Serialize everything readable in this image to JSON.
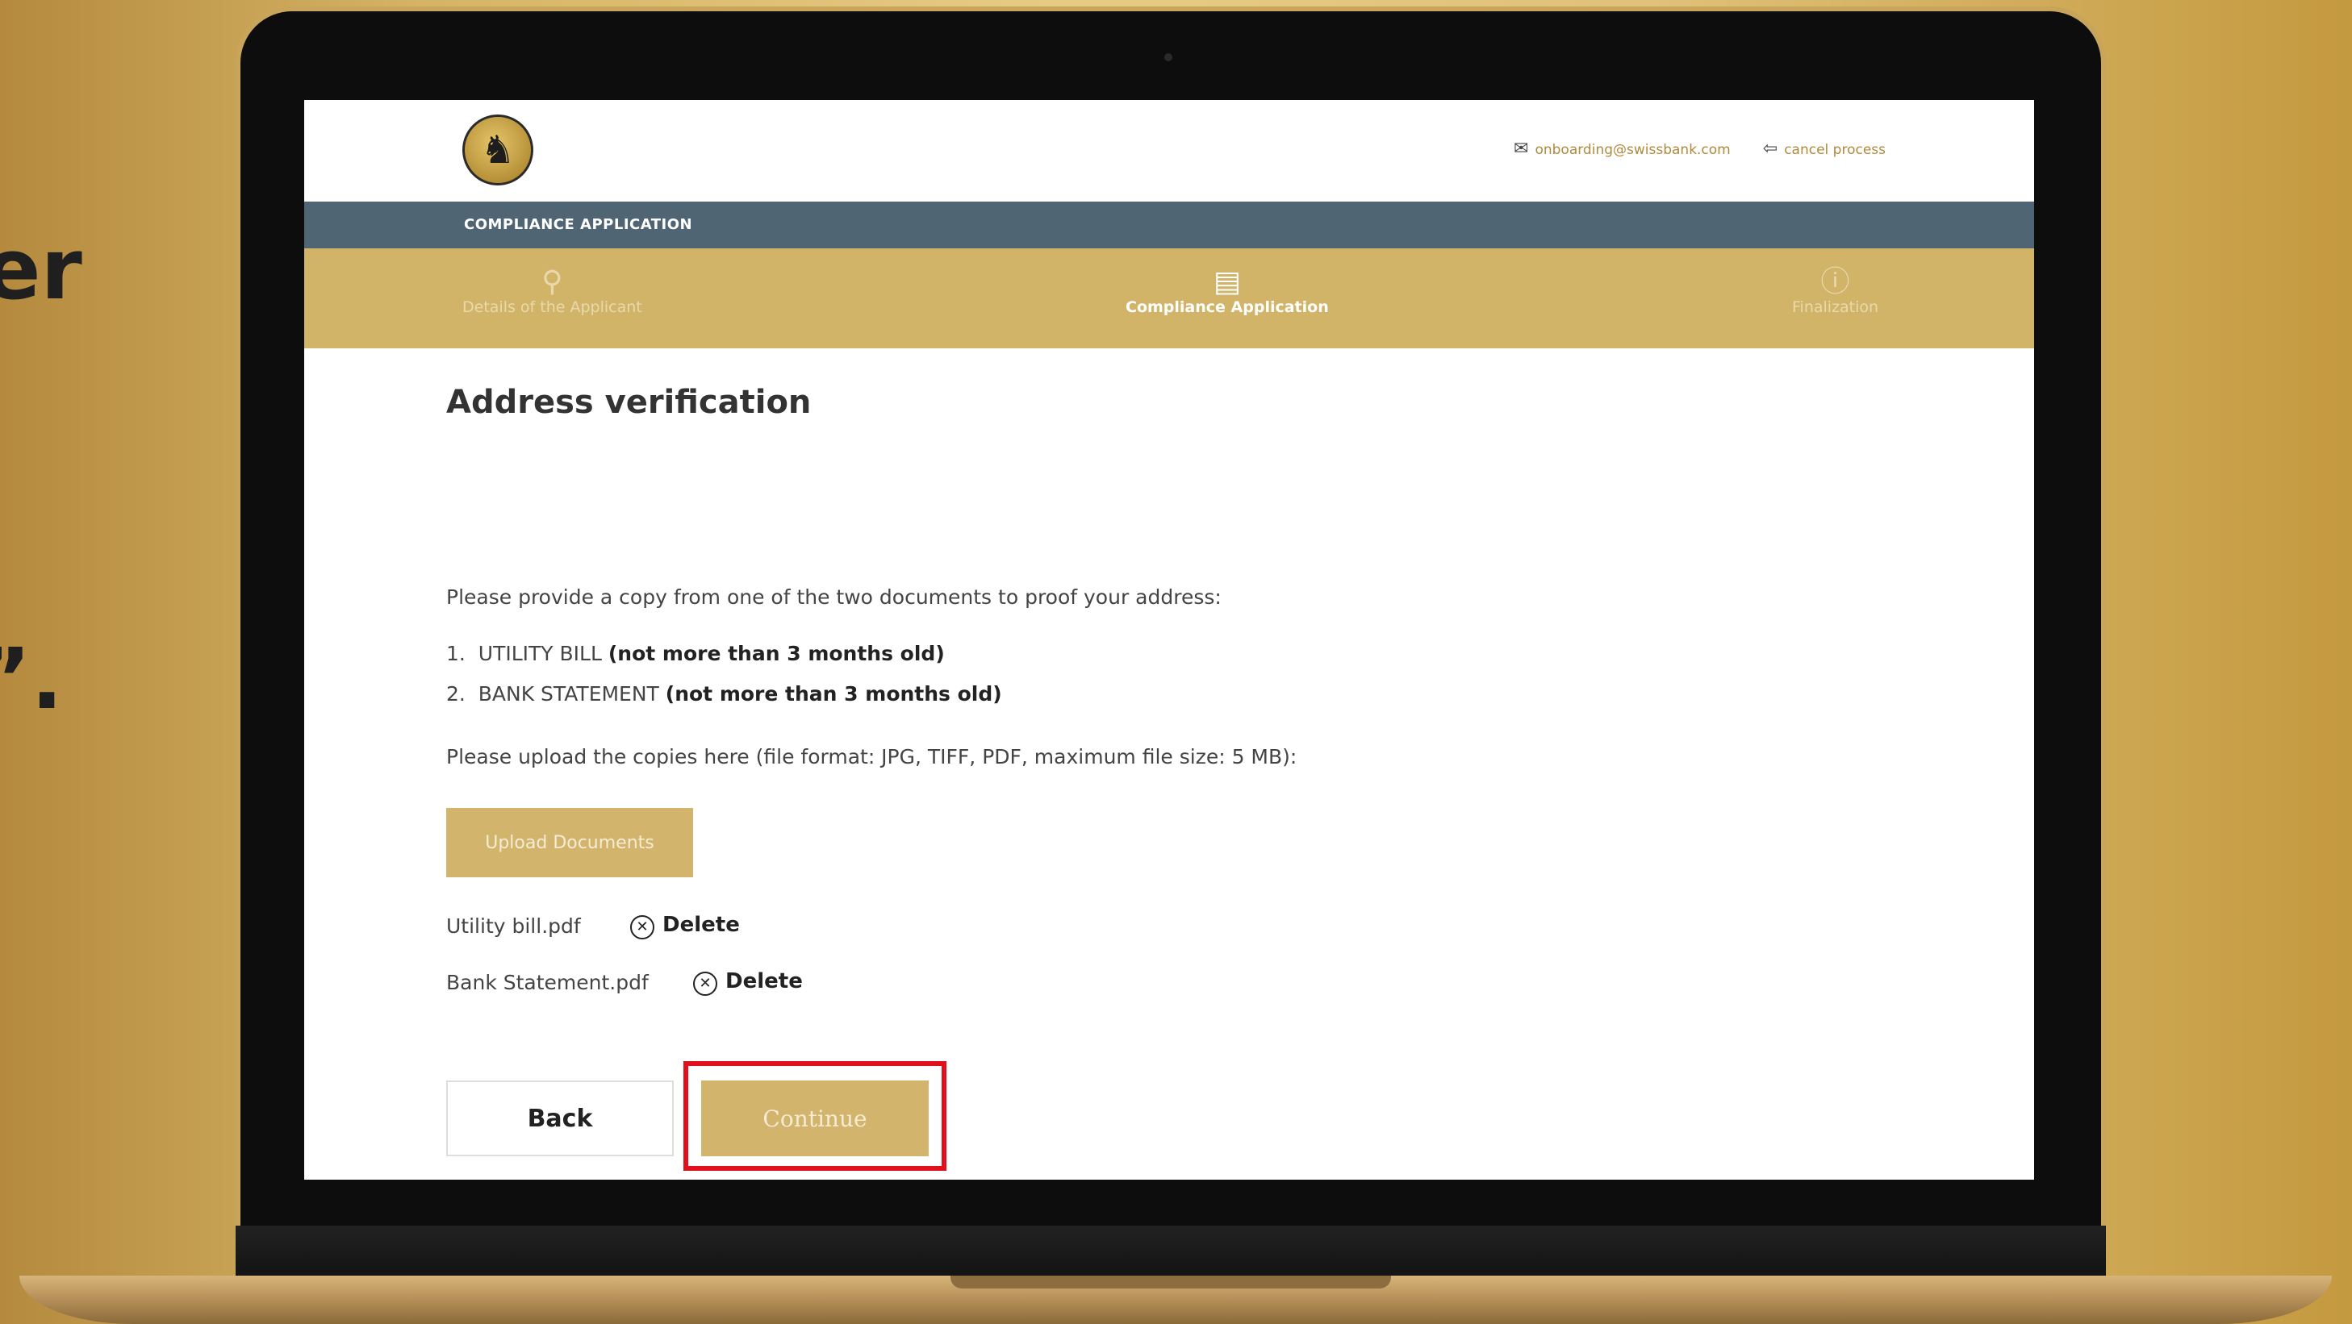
{
  "side_fragments": [
    "er",
    "”."
  ],
  "header": {
    "email": "onboarding@swissbank.com",
    "cancel": "cancel process",
    "section_title": "COMPLIANCE APPLICATION"
  },
  "steps": [
    {
      "label": "Details of the Applicant",
      "icon": "user-icon",
      "active": false
    },
    {
      "label": "Compliance Application",
      "icon": "document-icon",
      "active": true
    },
    {
      "label": "Finalization",
      "icon": "info-icon",
      "active": false
    }
  ],
  "page": {
    "title": "Address verification",
    "intro": "Please provide a copy from one of the two documents to proof your address:",
    "items": [
      {
        "num": "1.",
        "name": "UTILITY BILL",
        "note": "(not more than 3 months old)"
      },
      {
        "num": "2.",
        "name": "BANK STATEMENT",
        "note": "(not more than 3 months old)"
      }
    ],
    "upload_hint": "Please upload the copies here (file format: JPG, TIFF, PDF, maximum file size: 5 MB):",
    "upload_button": "Upload Documents",
    "files": [
      {
        "name": "Utility bill.pdf",
        "action": "Delete"
      },
      {
        "name": "Bank Statement.pdf",
        "action": "Delete"
      }
    ],
    "back_button": "Back",
    "continue_button": "Continue"
  },
  "colors": {
    "gold": "#d3b46c",
    "navy": "#4f6574",
    "highlight": "#e0111c"
  }
}
